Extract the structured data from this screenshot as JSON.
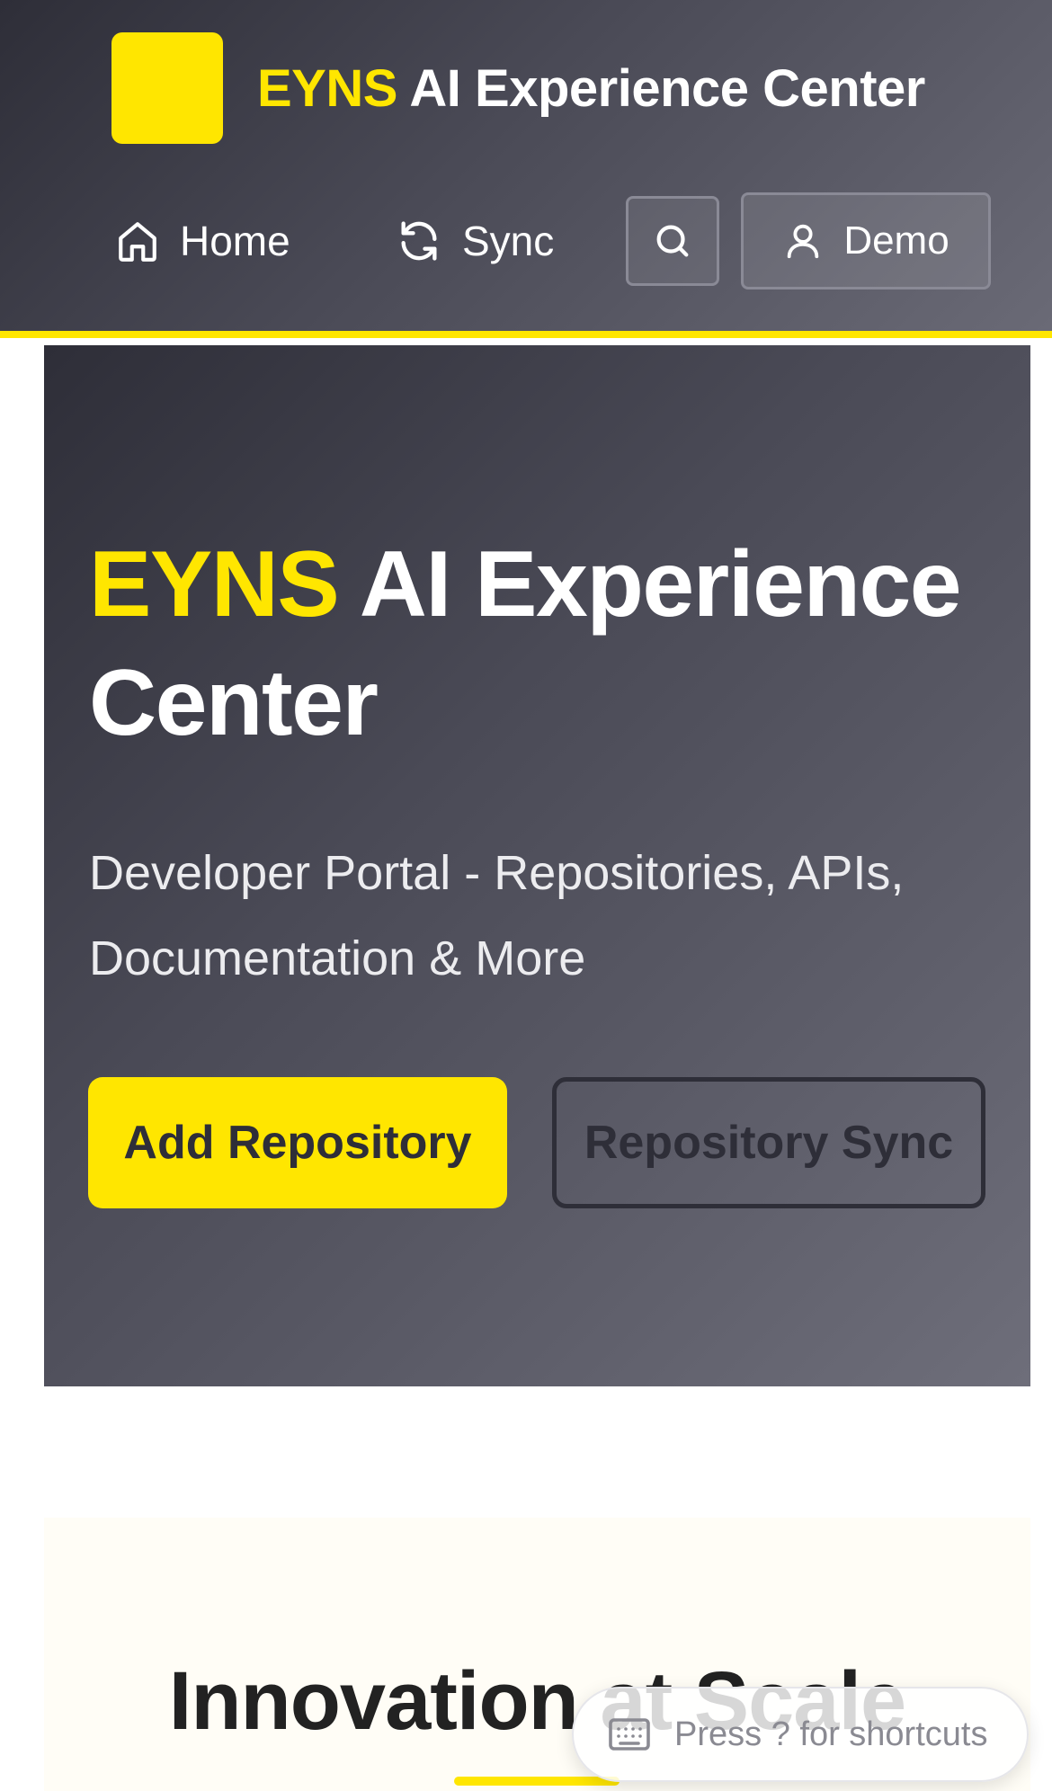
{
  "header": {
    "brand_accent": "EYNS",
    "brand_rest": "AI Experience Center",
    "nav": {
      "home_label": "Home",
      "sync_label": "Sync",
      "demo_label": "Demo"
    }
  },
  "hero": {
    "title_accent": "EYNS",
    "title_rest": "AI Experience Center",
    "subtitle": "Developer Portal - Repositories, APIs, Documentation & More",
    "primary_button": "Add Repository",
    "secondary_button": "Repository Sync"
  },
  "innovation": {
    "title": "Innovation at Scale"
  },
  "shortcuts": {
    "label": "Press ? for shortcuts"
  },
  "colors": {
    "accent": "#ffe600",
    "dark": "#2e2e38"
  },
  "icons": {
    "home": "home-icon",
    "sync": "refresh-icon",
    "search": "search-icon",
    "user": "user-icon",
    "keyboard": "keyboard-icon"
  }
}
